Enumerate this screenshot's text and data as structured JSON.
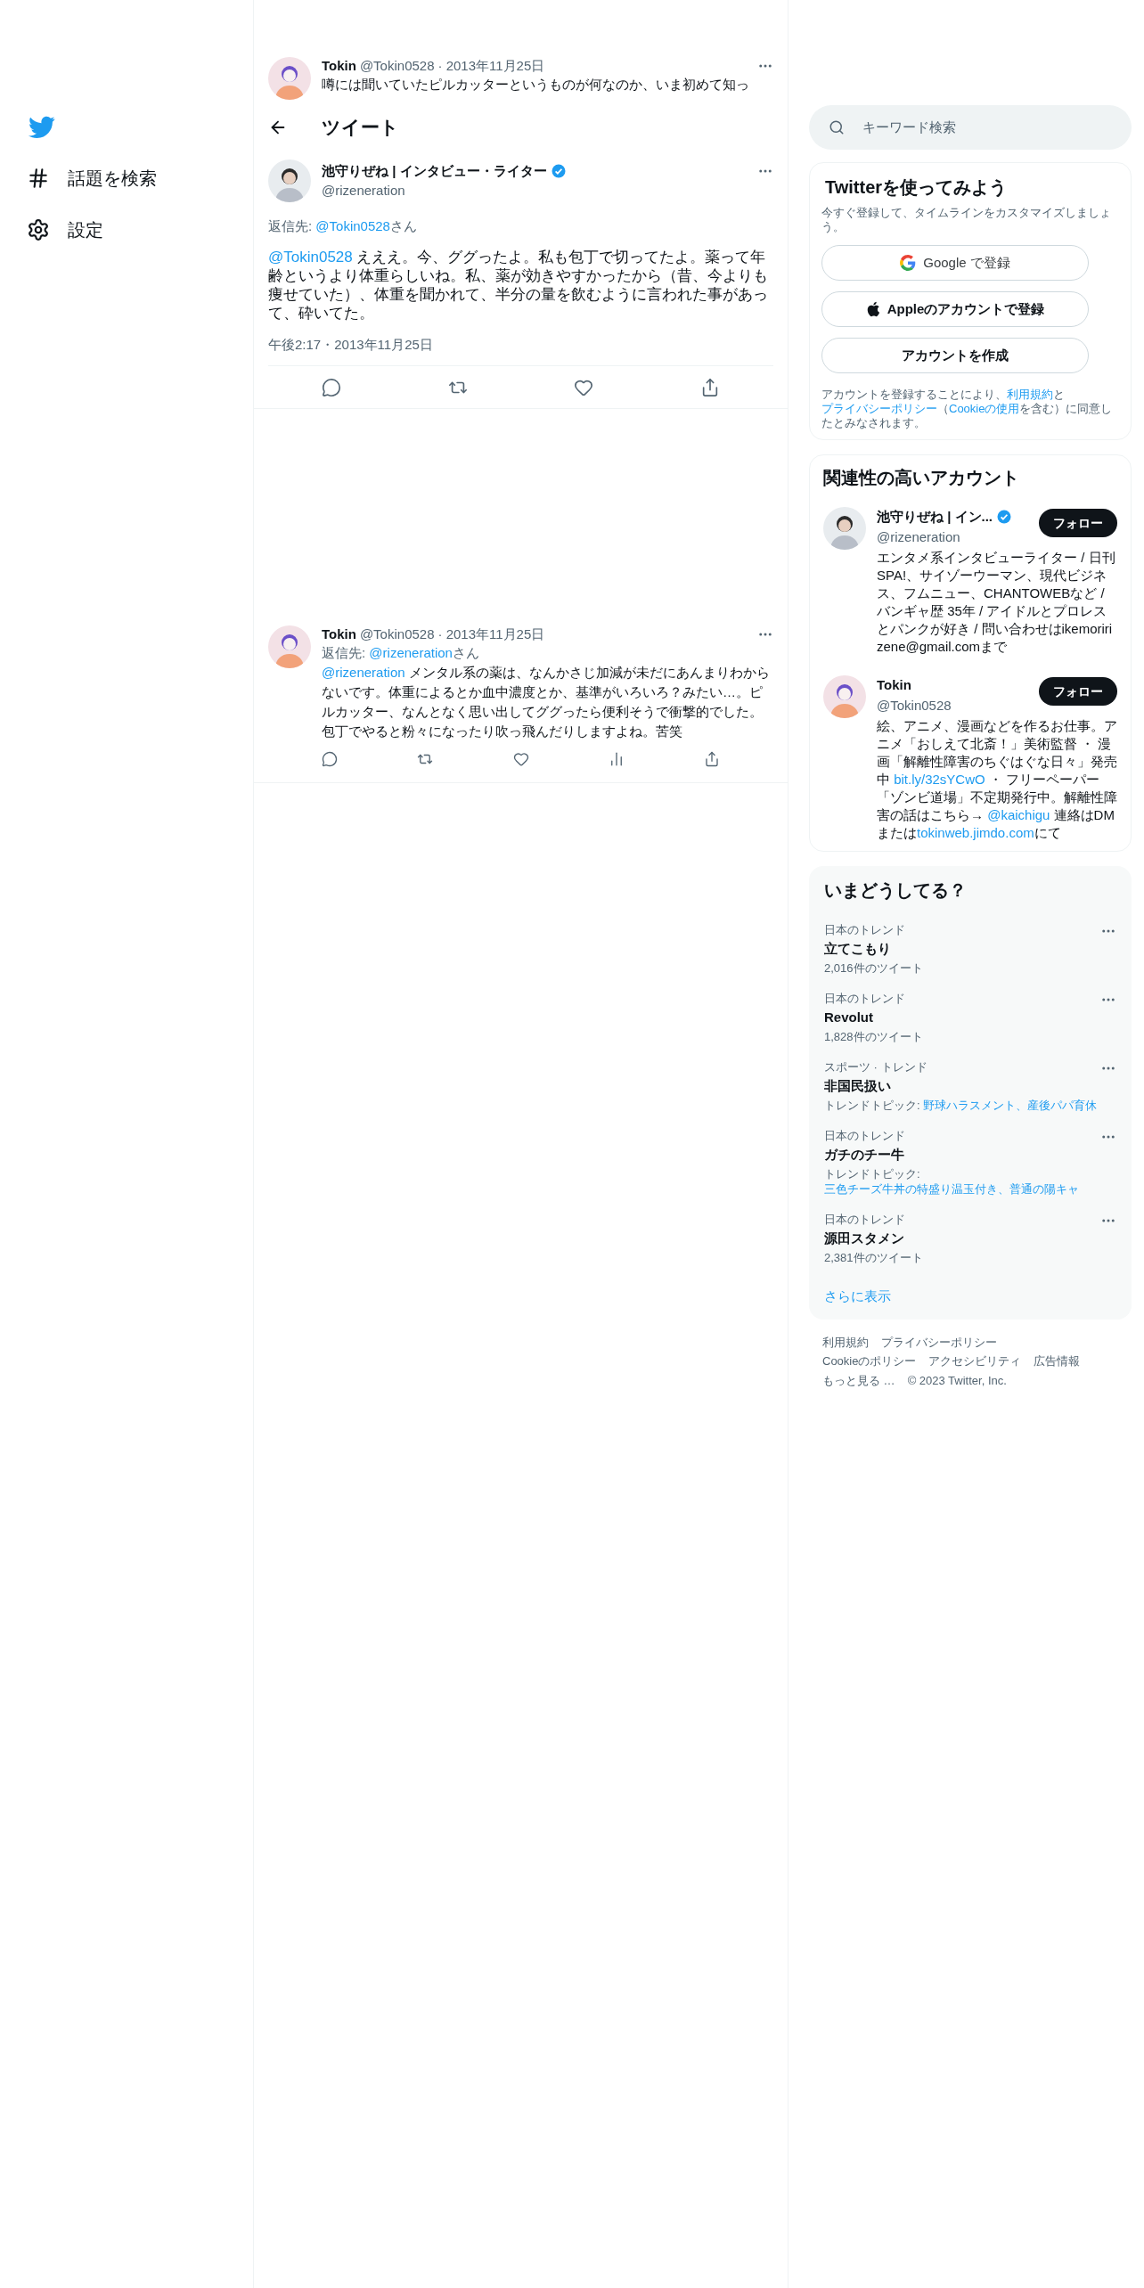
{
  "nav": {
    "items": [
      {
        "kind": "hashtag",
        "label": "話題を検索"
      },
      {
        "kind": "settings",
        "label": "設定"
      }
    ]
  },
  "top_tweet": {
    "name": "Tokin",
    "handle": "@Tokin0528",
    "date": "· 2013年11月25日",
    "text": "噂には聞いていたピルカッターというものが何なのか、いま初めて知っ"
  },
  "header": {
    "title": "ツイート"
  },
  "main_tweet": {
    "name": "池守りぜね | インタビュー・ライター",
    "verified": true,
    "handle": "@rizeneration",
    "reply_to": [
      {
        "kind": "text",
        "text": "返信先: "
      },
      {
        "kind": "link",
        "text": "@Tokin0528"
      },
      {
        "kind": "text",
        "text": "さん"
      }
    ],
    "text": [
      {
        "kind": "link",
        "text": "@Tokin0528"
      },
      {
        "kind": "text",
        "text": " えええ。今、ググったよ。私も包丁で切ってたよ。薬って年齢というより体重らしいね。私、薬が効きやすかったから（昔、今よりも痩せていた）、体重を聞かれて、半分の量を飲むように言われた事があって、砕いてた。"
      }
    ],
    "timestamp": "午後2:17・2013年11月25日",
    "actions": [
      {
        "kind": "reply"
      },
      {
        "kind": "retweet"
      },
      {
        "kind": "like"
      },
      {
        "kind": "share"
      }
    ]
  },
  "reply_tweet": {
    "name": "Tokin",
    "handle": "@Tokin0528",
    "date": "· 2013年11月25日",
    "reply_to": [
      {
        "kind": "text",
        "text": "返信先: "
      },
      {
        "kind": "link",
        "text": "@rizeneration"
      },
      {
        "kind": "text",
        "text": "さん"
      }
    ],
    "text": [
      {
        "kind": "link",
        "text": "@rizeneration"
      },
      {
        "kind": "text",
        "text": " メンタル系の薬は、なんかさじ加減が未だにあんまりわからないです。体重によるとか血中濃度とか、基準がいろいろ？みたい…。ピルカッター、なんとなく思い出してググったら便利そうで衝撃的でした。包丁でやると粉々になったり吹っ飛んだりしますよね。苦笑"
      }
    ],
    "actions": [
      {
        "kind": "reply"
      },
      {
        "kind": "retweet"
      },
      {
        "kind": "like"
      },
      {
        "kind": "analytics"
      },
      {
        "kind": "share"
      }
    ]
  },
  "search": {
    "placeholder": "キーワード検索"
  },
  "signup": {
    "title": "Twitterを使ってみよう",
    "subtitle": "今すぐ登録して、タイムラインをカスタマイズしましょう。",
    "buttons": [
      {
        "kind": "google",
        "label": "Google で登録"
      },
      {
        "kind": "apple",
        "label": "Appleのアカウントで登録"
      },
      {
        "kind": "plain",
        "label": "アカウントを作成"
      }
    ],
    "terms": [
      {
        "kind": "text",
        "text": "アカウントを登録することにより、"
      },
      {
        "kind": "link",
        "text": "利用規約"
      },
      {
        "kind": "text",
        "text": "と"
      },
      {
        "kind": "link",
        "text": "プライバシーポリシー"
      },
      {
        "kind": "text",
        "text": "（"
      },
      {
        "kind": "link",
        "text": "Cookieの使用"
      },
      {
        "kind": "text",
        "text": "を含む）に同意したとみなされます。"
      }
    ]
  },
  "related": {
    "title": "関連性の高いアカウント",
    "accounts": [
      {
        "name": "池守りぜね | イン...",
        "verified": true,
        "handle": "@rizeneration",
        "button": "フォロー",
        "bio": [
          {
            "kind": "text",
            "text": "エンタメ系インタビューライター / 日刊SPA!、サイゾーウーマン、現代ビジネス、フムニュー、CHANTOWEBなど / バンギャ歴 35年 / アイドルとプロレスとパンクが好き / 問い合わせはikemoririzene@gmail.comまで"
          }
        ]
      },
      {
        "name": "Tokin",
        "verified": false,
        "handle": "@Tokin0528",
        "button": "フォロー",
        "bio": [
          {
            "kind": "text",
            "text": "絵、アニメ、漫画などを作るお仕事。アニメ「おしえて北斎！」美術監督 ・ 漫画「解離性障害のちぐはぐな日々」発売中 "
          },
          {
            "kind": "link",
            "text": "bit.ly/32sYCwO"
          },
          {
            "kind": "text",
            "text": " ・ フリーペーパー「ゾンビ道場」不定期発行中。解離性障害の話はこちら→ "
          },
          {
            "kind": "link",
            "text": "@kaichigu"
          },
          {
            "kind": "text",
            "text": " 連絡はDMまたは"
          },
          {
            "kind": "link",
            "text": "tokinweb.jimdo.com"
          },
          {
            "kind": "text",
            "text": "にて"
          }
        ]
      }
    ]
  },
  "trends": {
    "title": "いまどうしてる？",
    "items": [
      {
        "context": "日本のトレンド",
        "name": "立てこもり",
        "detail": [
          {
            "kind": "text",
            "text": "2,016件のツイート"
          }
        ]
      },
      {
        "context": "日本のトレンド",
        "name": "Revolut",
        "detail": [
          {
            "kind": "text",
            "text": "1,828件のツイート"
          }
        ]
      },
      {
        "context": "スポーツ · トレンド",
        "name": "非国民扱い",
        "detail": [
          {
            "kind": "text",
            "text": "トレンドトピック: "
          },
          {
            "kind": "link",
            "text": "野球ハラスメント"
          },
          {
            "kind": "link",
            "text": "、"
          },
          {
            "kind": "link",
            "text": "産後パパ育休"
          }
        ]
      },
      {
        "context": "日本のトレンド",
        "name": "ガチのチー牛",
        "detail": [
          {
            "kind": "text",
            "text": "トレンドトピック: "
          },
          {
            "kind": "link",
            "text": "三色チーズ牛丼の特盛り温玉付き"
          },
          {
            "kind": "link",
            "text": "、"
          },
          {
            "kind": "link",
            "text": "普通の陽キャ"
          }
        ]
      },
      {
        "context": "日本のトレンド",
        "name": "源田スタメン",
        "detail": [
          {
            "kind": "text",
            "text": "2,381件のツイート"
          }
        ]
      }
    ],
    "more": "さらに表示"
  },
  "footer": {
    "rows": [
      [
        "利用規約",
        "プライバシーポリシー"
      ],
      [
        "Cookieのポリシー",
        "アクセシビリティ",
        "広告情報"
      ],
      [
        "もっと見る …",
        "© 2023 Twitter, Inc."
      ]
    ]
  }
}
